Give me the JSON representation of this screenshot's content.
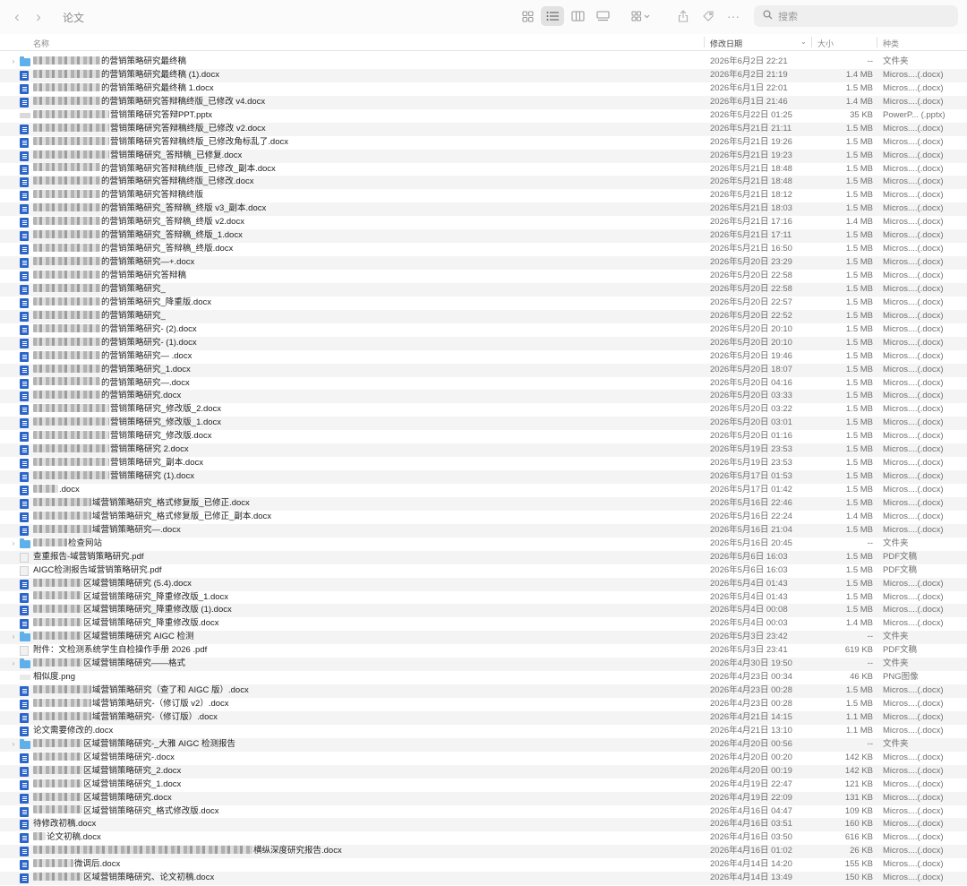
{
  "toolbar": {
    "title": "论文",
    "search_placeholder": "搜索"
  },
  "columns": {
    "name": "名称",
    "modified": "修改日期",
    "size": "大小",
    "kind": "种类"
  },
  "files": [
    {
      "name": "的营销策略研究最终稿",
      "date": "2026年6月2日 22:21",
      "size": "--",
      "kind": "文件夹",
      "type": "folder",
      "blur": 75
    },
    {
      "name": "的营销策略研究最终稿 (1).docx",
      "date": "2026年6月2日 21:19",
      "size": "1.4 MB",
      "kind": "Micros....(.docx)",
      "type": "doc",
      "blur": 75
    },
    {
      "name": "的营销策略研究最终稿 1.docx",
      "date": "2026年6月1日 22:01",
      "size": "1.5 MB",
      "kind": "Micros....(.docx)",
      "type": "doc",
      "blur": 75
    },
    {
      "name": "的营销策略研究答辩稿终版_已修改 v4.docx",
      "date": "2026年6月1日 21:46",
      "size": "1.4 MB",
      "kind": "Micros....(.docx)",
      "type": "doc",
      "blur": 75
    },
    {
      "name": "营销策略研究答辩PPT.pptx",
      "date": "2026年5月22日 01:25",
      "size": "35 KB",
      "kind": "PowerP... (.pptx)",
      "type": "ppt",
      "blur": 85
    },
    {
      "name": "营销策略研究答辩稿终版_已修改 v2.docx",
      "date": "2026年5月21日 21:11",
      "size": "1.5 MB",
      "kind": "Micros....(.docx)",
      "type": "doc",
      "blur": 85
    },
    {
      "name": "营销策略研究答辩稿终版_已修改角标乱了.docx",
      "date": "2026年5月21日 19:26",
      "size": "1.5 MB",
      "kind": "Micros....(.docx)",
      "type": "doc",
      "blur": 85
    },
    {
      "name": "营销策略研究_答辩稿_已修复.docx",
      "date": "2026年5月21日 19:23",
      "size": "1.5 MB",
      "kind": "Micros....(.docx)",
      "type": "doc",
      "blur": 85
    },
    {
      "name": "的营销策略研究答辩稿终版_已修改_副本.docx",
      "date": "2026年5月21日 18:48",
      "size": "1.5 MB",
      "kind": "Micros....(.docx)",
      "type": "doc",
      "blur": 75
    },
    {
      "name": "的营销策略研究答辩稿终版_已修改.docx",
      "date": "2026年5月21日 18:48",
      "size": "1.5 MB",
      "kind": "Micros....(.docx)",
      "type": "doc",
      "blur": 75
    },
    {
      "name": "的营销策略研究答辩稿终版",
      "date": "2026年5月21日 18:12",
      "size": "1.5 MB",
      "kind": "Micros....(.docx)",
      "type": "doc",
      "blur": 75
    },
    {
      "name": "的营销策略研究_答辩稿_终版 v3_副本.docx",
      "date": "2026年5月21日 18:03",
      "size": "1.5 MB",
      "kind": "Micros....(.docx)",
      "type": "doc",
      "blur": 75
    },
    {
      "name": "的营销策略研究_答辩稿_终版 v2.docx",
      "date": "2026年5月21日 17:16",
      "size": "1.4 MB",
      "kind": "Micros....(.docx)",
      "type": "doc",
      "blur": 75
    },
    {
      "name": "的营销策略研究_答辩稿_终版_1.docx",
      "date": "2026年5月21日 17:11",
      "size": "1.5 MB",
      "kind": "Micros....(.docx)",
      "type": "doc",
      "blur": 75
    },
    {
      "name": "的营销策略研究_答辩稿_终版.docx",
      "date": "2026年5月21日 16:50",
      "size": "1.5 MB",
      "kind": "Micros....(.docx)",
      "type": "doc",
      "blur": 75
    },
    {
      "name": "的营销策略研究—+.docx",
      "date": "2026年5月20日 23:29",
      "size": "1.5 MB",
      "kind": "Micros....(.docx)",
      "type": "doc",
      "blur": 75
    },
    {
      "name": "的营销策略研究答辩稿",
      "date": "2026年5月20日 22:58",
      "size": "1.5 MB",
      "kind": "Micros....(.docx)",
      "type": "doc",
      "blur": 75
    },
    {
      "name": "的营销策略研究_",
      "date": "2026年5月20日 22:58",
      "size": "1.5 MB",
      "kind": "Micros....(.docx)",
      "type": "doc",
      "blur": 75
    },
    {
      "name": "的营销策略研究_降重版.docx",
      "date": "2026年5月20日 22:57",
      "size": "1.5 MB",
      "kind": "Micros....(.docx)",
      "type": "doc",
      "blur": 75
    },
    {
      "name": "的营销策略研究_",
      "date": "2026年5月20日 22:52",
      "size": "1.5 MB",
      "kind": "Micros....(.docx)",
      "type": "doc",
      "blur": 75
    },
    {
      "name": "的营销策略研究- (2).docx",
      "date": "2026年5月20日 20:10",
      "size": "1.5 MB",
      "kind": "Micros....(.docx)",
      "type": "doc",
      "blur": 75
    },
    {
      "name": "的营销策略研究- (1).docx",
      "date": "2026年5月20日 20:10",
      "size": "1.5 MB",
      "kind": "Micros....(.docx)",
      "type": "doc",
      "blur": 75
    },
    {
      "name": "的营销策略研究— .docx",
      "date": "2026年5月20日 19:46",
      "size": "1.5 MB",
      "kind": "Micros....(.docx)",
      "type": "doc",
      "blur": 75
    },
    {
      "name": "的营销策略研究_1.docx",
      "date": "2026年5月20日 18:07",
      "size": "1.5 MB",
      "kind": "Micros....(.docx)",
      "type": "doc",
      "blur": 75
    },
    {
      "name": "的营销策略研究—.docx",
      "date": "2026年5月20日 04:16",
      "size": "1.5 MB",
      "kind": "Micros....(.docx)",
      "type": "doc",
      "blur": 75
    },
    {
      "name": "的营销策略研究.docx",
      "date": "2026年5月20日 03:33",
      "size": "1.5 MB",
      "kind": "Micros....(.docx)",
      "type": "doc",
      "blur": 75
    },
    {
      "name": "营销策略研究_修改版_2.docx",
      "date": "2026年5月20日 03:22",
      "size": "1.5 MB",
      "kind": "Micros....(.docx)",
      "type": "doc",
      "blur": 85
    },
    {
      "name": "营销策略研究_修改版_1.docx",
      "date": "2026年5月20日 03:01",
      "size": "1.5 MB",
      "kind": "Micros....(.docx)",
      "type": "doc",
      "blur": 85
    },
    {
      "name": "营销策略研究_修改版.docx",
      "date": "2026年5月20日 01:16",
      "size": "1.5 MB",
      "kind": "Micros....(.docx)",
      "type": "doc",
      "blur": 85
    },
    {
      "name": "营销策略研究 2.docx",
      "date": "2026年5月19日 23:53",
      "size": "1.5 MB",
      "kind": "Micros....(.docx)",
      "type": "doc",
      "blur": 85
    },
    {
      "name": "营销策略研究_副本.docx",
      "date": "2026年5月19日 23:53",
      "size": "1.5 MB",
      "kind": "Micros....(.docx)",
      "type": "doc",
      "blur": 85
    },
    {
      "name": "营销策略研究 (1).docx",
      "date": "2026年5月17日 01:53",
      "size": "1.5 MB",
      "kind": "Micros....(.docx)",
      "type": "doc",
      "blur": 85
    },
    {
      "name": ".docx",
      "date": "2026年5月17日 01:42",
      "size": "1.5 MB",
      "kind": "Micros....(.docx)",
      "type": "doc",
      "blur": 28
    },
    {
      "name": "域营销策略研究_格式修复版_已修正.docx",
      "date": "2026年5月16日 22:46",
      "size": "1.5 MB",
      "kind": "Micros....(.docx)",
      "type": "doc",
      "blur": 65
    },
    {
      "name": "域营销策略研究_格式修复版_已修正_副本.docx",
      "date": "2026年5月16日 22:24",
      "size": "1.4 MB",
      "kind": "Micros....(.docx)",
      "type": "doc",
      "blur": 65
    },
    {
      "name": "域营销策略研究—.docx",
      "date": "2026年5月16日 21:04",
      "size": "1.5 MB",
      "kind": "Micros....(.docx)",
      "type": "doc",
      "blur": 65
    },
    {
      "name": "检查网站",
      "date": "2026年5月16日 20:45",
      "size": "--",
      "kind": "文件夹",
      "type": "folder",
      "blur": 38
    },
    {
      "name": "查重报告-域营销策略研究.pdf",
      "date": "2026年5月6日 16:03",
      "size": "1.5 MB",
      "kind": "PDF文稿",
      "type": "pdf",
      "blur": 0
    },
    {
      "name": "AIGC检测报告域营销策略研究.pdf",
      "date": "2026年5月6日 16:03",
      "size": "1.5 MB",
      "kind": "PDF文稿",
      "type": "pdf",
      "blur": 0
    },
    {
      "name": "区域营销策略研究 (5.4).docx",
      "date": "2026年5月4日 01:43",
      "size": "1.5 MB",
      "kind": "Micros....(.docx)",
      "type": "doc",
      "blur": 55
    },
    {
      "name": "区域营销策略研究_降重修改版_1.docx",
      "date": "2026年5月4日 01:43",
      "size": "1.5 MB",
      "kind": "Micros....(.docx)",
      "type": "doc",
      "blur": 55
    },
    {
      "name": "区域营销策略研究_降重修改版 (1).docx",
      "date": "2026年5月4日 00:08",
      "size": "1.5 MB",
      "kind": "Micros....(.docx)",
      "type": "doc",
      "blur": 55
    },
    {
      "name": "区域营销策略研究_降重修改版.docx",
      "date": "2026年5月4日 00:03",
      "size": "1.4 MB",
      "kind": "Micros....(.docx)",
      "type": "doc",
      "blur": 55
    },
    {
      "name": "区域营销策略研究 AIGC 检测",
      "date": "2026年5月3日 23:42",
      "size": "--",
      "kind": "文件夹",
      "type": "folder",
      "blur": 55
    },
    {
      "name": "附件：文检测系统学生自检操作手册 2026 .pdf",
      "date": "2026年5月3日 23:41",
      "size": "619 KB",
      "kind": "PDF文稿",
      "type": "pdf",
      "blur": 0
    },
    {
      "name": "区域营销策略研究——格式",
      "date": "2026年4月30日 19:50",
      "size": "--",
      "kind": "文件夹",
      "type": "folder",
      "blur": 55
    },
    {
      "name": "相似度.png",
      "date": "2026年4月23日 00:34",
      "size": "46 KB",
      "kind": "PNG图像",
      "type": "png",
      "blur": 0
    },
    {
      "name": "域营销策略研究（查了和 AIGC 版）.docx",
      "date": "2026年4月23日 00:28",
      "size": "1.5 MB",
      "kind": "Micros....(.docx)",
      "type": "doc",
      "blur": 65
    },
    {
      "name": "域营销策略研究-（修订版 v2）.docx",
      "date": "2026年4月23日 00:28",
      "size": "1.5 MB",
      "kind": "Micros....(.docx)",
      "type": "doc",
      "blur": 65
    },
    {
      "name": "域营销策略研究-（修订版）.docx",
      "date": "2026年4月21日 14:15",
      "size": "1.1 MB",
      "kind": "Micros....(.docx)",
      "type": "doc",
      "blur": 65
    },
    {
      "name": "论文需要修改的.docx",
      "date": "2026年4月21日 13:10",
      "size": "1.1 MB",
      "kind": "Micros....(.docx)",
      "type": "doc",
      "blur": 0
    },
    {
      "name": "区域营销策略研究-_大雅 AIGC 检测报告",
      "date": "2026年4月20日 00:56",
      "size": "--",
      "kind": "文件夹",
      "type": "folder",
      "blur": 55
    },
    {
      "name": "区域营销策略研究-.docx",
      "date": "2026年4月20日 00:20",
      "size": "142 KB",
      "kind": "Micros....(.docx)",
      "type": "doc",
      "blur": 55
    },
    {
      "name": "区域营销策略研究_2.docx",
      "date": "2026年4月20日 00:19",
      "size": "142 KB",
      "kind": "Micros....(.docx)",
      "type": "doc",
      "blur": 55
    },
    {
      "name": "区域营销策略研究_1.docx",
      "date": "2026年4月19日 22:47",
      "size": "121 KB",
      "kind": "Micros....(.docx)",
      "type": "doc",
      "blur": 55
    },
    {
      "name": "区域营销策略研究.docx",
      "date": "2026年4月19日 22:09",
      "size": "131 KB",
      "kind": "Micros....(.docx)",
      "type": "doc",
      "blur": 55
    },
    {
      "name": "区域营销策略研究_格式修改版.docx",
      "date": "2026年4月16日 04:47",
      "size": "109 KB",
      "kind": "Micros....(.docx)",
      "type": "doc",
      "blur": 55
    },
    {
      "name": "待修改初稿.docx",
      "date": "2026年4月16日 03:51",
      "size": "160 KB",
      "kind": "Micros....(.docx)",
      "type": "doc",
      "blur": 0
    },
    {
      "name": "论文初稿.docx",
      "date": "2026年4月16日 03:50",
      "size": "616 KB",
      "kind": "Micros....(.docx)",
      "type": "doc",
      "blur": 14
    },
    {
      "name": "横纵深度研究报告.docx",
      "date": "2026年4月16日 01:02",
      "size": "26 KB",
      "kind": "Micros....(.docx)",
      "type": "doc",
      "blur": 245
    },
    {
      "name": "微调后.docx",
      "date": "2026年4月14日 14:20",
      "size": "155 KB",
      "kind": "Micros....(.docx)",
      "type": "doc",
      "blur": 45
    },
    {
      "name": "区域营销策略研究、论文初稿.docx",
      "date": "2026年4月14日 13:49",
      "size": "150 KB",
      "kind": "Micros....(.docx)",
      "type": "doc",
      "blur": 55
    }
  ]
}
